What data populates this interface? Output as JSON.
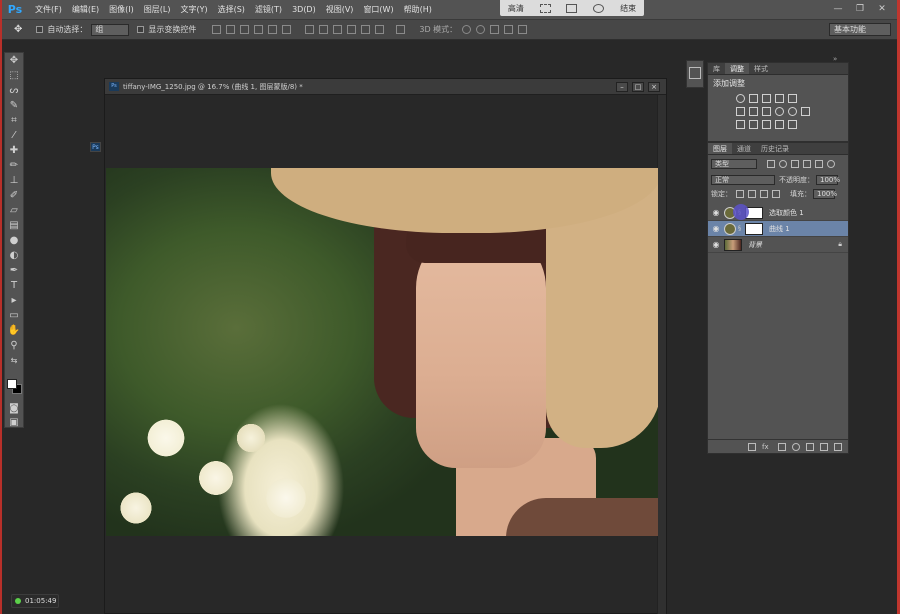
{
  "app": {
    "logo": "Ps"
  },
  "menu": [
    "文件(F)",
    "编辑(E)",
    "图像(I)",
    "图层(L)",
    "文字(Y)",
    "选择(S)",
    "滤镜(T)",
    "3D(D)",
    "视图(V)",
    "窗口(W)",
    "帮助(H)"
  ],
  "mode_box": {
    "label_left": "高清",
    "label_right": "结束"
  },
  "options": {
    "auto_select_label": "自动选择：",
    "auto_select_value": "组",
    "show_transform_label": "显示变换控件",
    "mode3d_label": "3D 模式："
  },
  "workspace": "基本功能",
  "document": {
    "title": "tiffany-IMG_1250.jpg @ 16.7% (曲线 1, 图层蒙版/8) *",
    "ps_mini": "Ps"
  },
  "panel_adjust": {
    "tabs": [
      "库",
      "调整",
      "样式"
    ],
    "active_tab": 1,
    "heading": "添加调整"
  },
  "panel_layers": {
    "tabs": [
      "图层",
      "通道",
      "历史记录"
    ],
    "active_tab": 0,
    "filter_label": "类型",
    "blend_mode": "正常",
    "opacity_label": "不透明度：",
    "opacity_value": "100%",
    "lock_label": "锁定：",
    "fill_label": "填充：",
    "fill_value": "100%",
    "layers": [
      {
        "name": "选取颜色 1",
        "type": "adjustment",
        "selected": false
      },
      {
        "name": "曲线 1",
        "type": "adjustment",
        "selected": true
      },
      {
        "name": "背景",
        "type": "image",
        "selected": false,
        "locked": true
      }
    ]
  },
  "timer": "01:05:49",
  "icons": {
    "eye": "eye-icon",
    "lock": "lock-icon",
    "link": "chain-link-icon"
  }
}
